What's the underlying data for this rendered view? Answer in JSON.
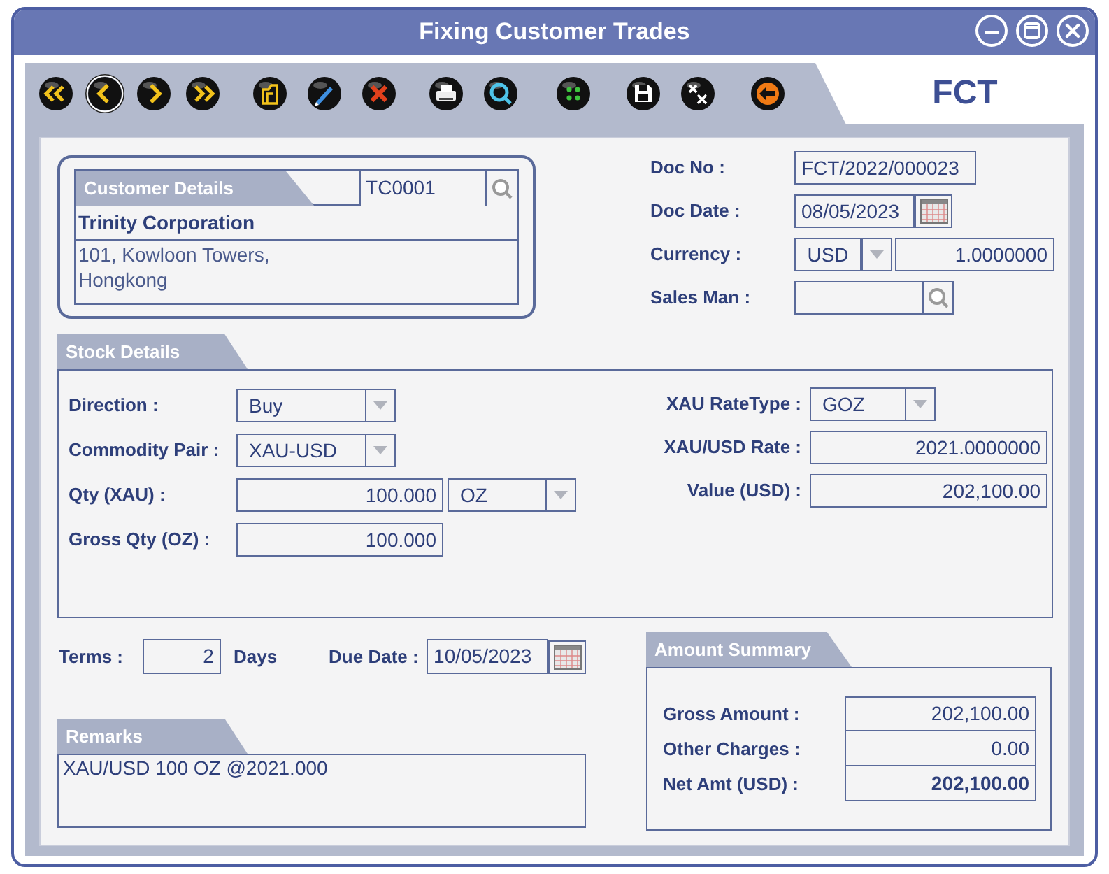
{
  "window": {
    "title": "Fixing Customer Trades"
  },
  "window_controls": [
    {
      "kind": "minimize"
    },
    {
      "kind": "maximize"
    },
    {
      "kind": "close"
    }
  ],
  "toolbar": [
    {
      "kind": "first",
      "selected": false
    },
    {
      "kind": "prev",
      "selected": true
    },
    {
      "kind": "next",
      "selected": false
    },
    {
      "kind": "last",
      "selected": false
    },
    {
      "kind": "folder",
      "selected": false
    },
    {
      "kind": "pen",
      "selected": false
    },
    {
      "kind": "delete",
      "selected": false
    },
    {
      "kind": "print",
      "selected": false
    },
    {
      "kind": "preview",
      "selected": false
    },
    {
      "kind": "dots",
      "selected": false
    },
    {
      "kind": "save",
      "selected": false
    },
    {
      "kind": "clear",
      "selected": false
    },
    {
      "kind": "exit",
      "selected": false
    }
  ],
  "form_code": "FCT",
  "customer_details": {
    "title": "Customer Details",
    "code": "TC0001",
    "name": "Trinity Corporation",
    "address_lines": [
      "101, Kowloon Towers,",
      "Hongkong"
    ]
  },
  "document_fields": [
    {
      "kind": "text",
      "label": "Doc No :",
      "value": "FCT/2022/000023"
    },
    {
      "kind": "date",
      "label": "Doc Date :",
      "value": "08/05/2023"
    },
    {
      "kind": "currency",
      "label": "Currency :",
      "value": "USD",
      "rate": "1.0000000"
    },
    {
      "kind": "lookup",
      "label": "Sales Man :"
    }
  ],
  "stock_details": {
    "title": "Stock Details",
    "left_fields": [
      {
        "kind": "select",
        "label": "Direction :",
        "value": "Buy"
      },
      {
        "kind": "select",
        "label": "Commodity Pair :",
        "value": "XAU-USD"
      },
      {
        "kind": "quantity",
        "label": "Qty (XAU) :",
        "value": "100.000",
        "unit": "OZ"
      },
      {
        "kind": "number",
        "label": "Gross Qty (OZ) :",
        "value": "100.000"
      }
    ],
    "right_fields": [
      {
        "kind": "select",
        "label": "XAU RateType :",
        "value": "GOZ"
      },
      {
        "kind": "number",
        "label": "XAU/USD Rate :",
        "value": "2021.0000000"
      },
      {
        "kind": "number",
        "label": "Value (USD) :",
        "value": "202,100.00"
      }
    ]
  },
  "terms": {
    "label": "Terms :",
    "value": "2",
    "unit": "Days"
  },
  "due_date": {
    "label": "Due Date :",
    "value": "10/05/2023"
  },
  "remarks": {
    "title": "Remarks",
    "value": "XAU/USD 100 OZ @2021.000"
  },
  "amount_summary": {
    "title": "Amount Summary",
    "rows": [
      {
        "label": "Gross Amount :",
        "value": "202,100.00",
        "bold": false
      },
      {
        "label": "Other Charges :",
        "value": "0.00",
        "bold": false
      },
      {
        "label": "Net Amt (USD) :",
        "value": "202,100.00",
        "bold": true
      }
    ]
  }
}
